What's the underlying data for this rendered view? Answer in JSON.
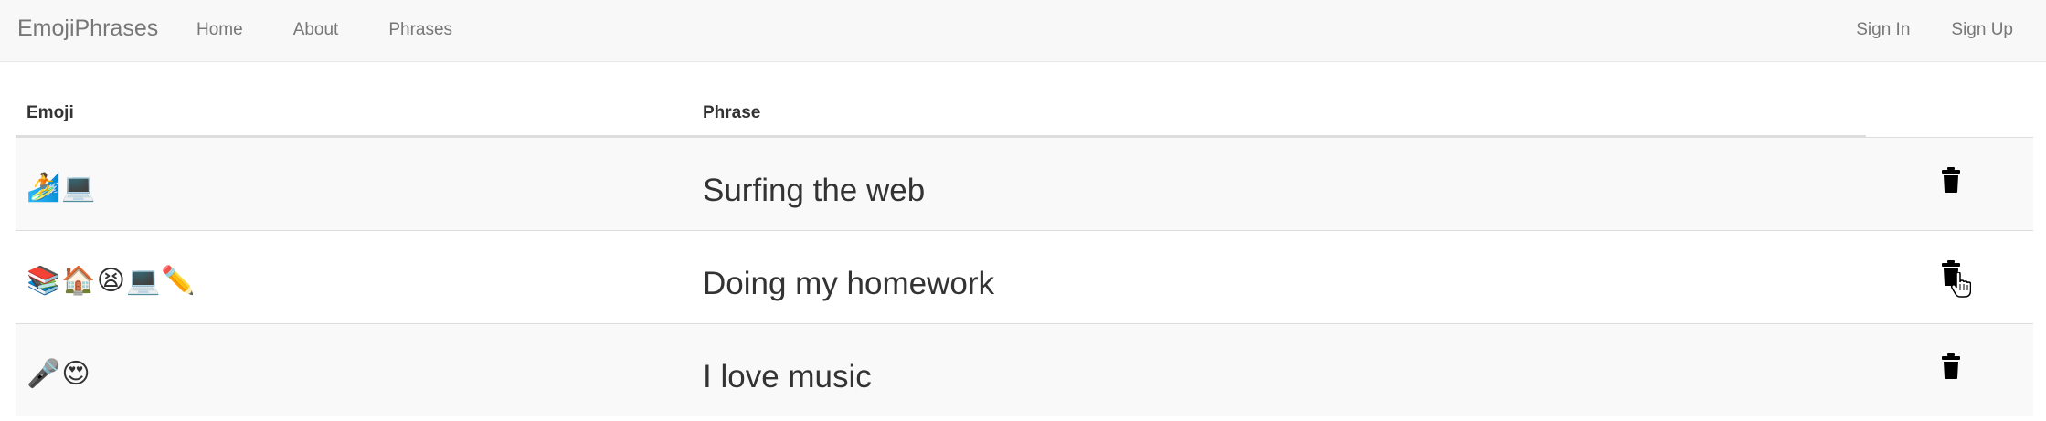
{
  "nav": {
    "brand": "EmojiPhrases",
    "left_links": [
      "Home",
      "About",
      "Phrases"
    ],
    "right_links": [
      "Sign In",
      "Sign Up"
    ]
  },
  "table": {
    "headers": {
      "emoji": "Emoji",
      "phrase": "Phrase"
    },
    "rows": [
      {
        "emoji": "🏄💻",
        "phrase": "Surfing the web"
      },
      {
        "emoji": "📚🏠😫💻✏️",
        "phrase": "Doing my homework"
      },
      {
        "emoji": "🎤😍",
        "phrase": "I love music"
      }
    ],
    "delete_icon": "trash-icon",
    "hover_row_index": 1
  },
  "colors": {
    "navbar_bg": "#f8f8f8",
    "stripe_bg": "#f9f9f9",
    "text": "#333333",
    "nav_text": "#777777"
  }
}
